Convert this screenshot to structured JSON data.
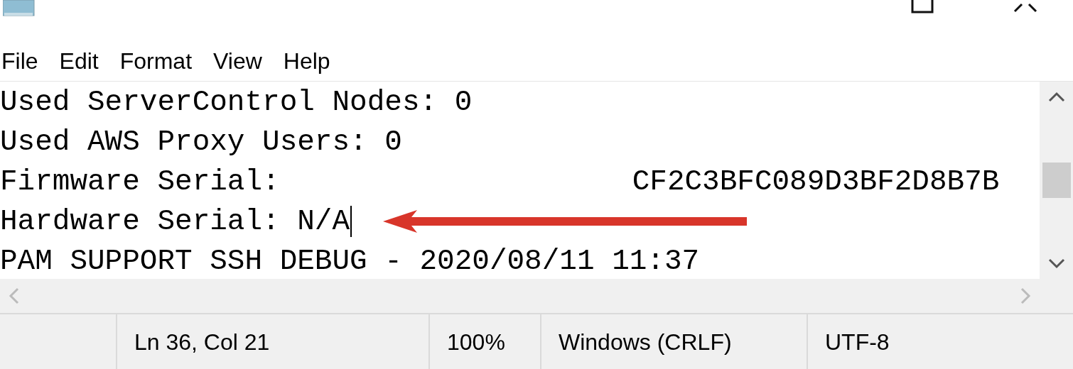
{
  "menu": [
    {
      "label": "File"
    },
    {
      "label": "Edit"
    },
    {
      "label": "Format"
    },
    {
      "label": "View"
    },
    {
      "label": "Help"
    }
  ],
  "lines": [
    {
      "text": "Used ServerControl Nodes: 0",
      "caret": false
    },
    {
      "text": "Used AWS Proxy Users: 0",
      "caret": false
    },
    {
      "text": "Firmware Serial:",
      "value": "CF2C3BFC089D3BF2D8B7B",
      "caret": false
    },
    {
      "text": "Hardware Serial: N/A",
      "caret": true
    },
    {
      "text": "PAM SUPPORT SSH DEBUG - 2020/08/11 11:37",
      "caret": false
    }
  ],
  "status_bar": [
    "Ln 36, Col 21",
    "100%",
    "Windows (CRLF)",
    "UTF-8"
  ]
}
